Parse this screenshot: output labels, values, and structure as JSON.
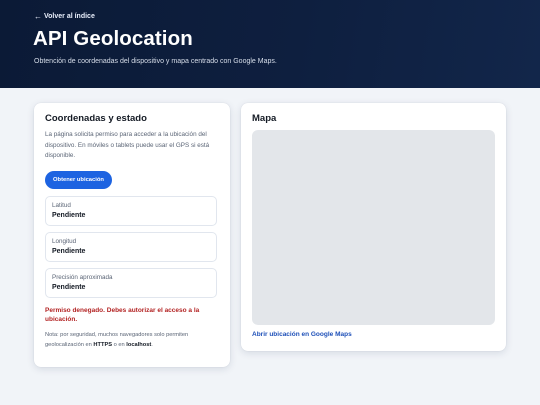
{
  "header": {
    "back_label": "Volver al índice",
    "title": "API Geolocation",
    "subtitle": "Obtención de coordenadas del dispositivo y mapa centrado con Google Maps."
  },
  "status_card": {
    "title": "Coordenadas y estado",
    "description": "La página solicita permiso para acceder a la ubicación del dispositivo. En móviles o tablets puede usar el GPS si está disponible.",
    "button_label": "Obtener ubicación",
    "fields": [
      {
        "label": "Latitud",
        "value": "Pendiente"
      },
      {
        "label": "Longitud",
        "value": "Pendiente"
      },
      {
        "label": "Precisión aproximada",
        "value": "Pendiente"
      }
    ],
    "error_message": "Permiso denegado. Debes autorizar el acceso a la ubicación.",
    "note": {
      "prefix": "Nota: por seguridad, muchos navegadores solo permiten geolocalización en ",
      "https": "HTTPS",
      "middle": " o en ",
      "localhost": "localhost",
      "suffix": "."
    }
  },
  "map_card": {
    "title": "Mapa",
    "link_label": "Abrir ubicación en Google Maps"
  },
  "colors": {
    "header_bg": "#0e1f3f",
    "accent": "#1d63e1",
    "error": "#b32323",
    "link": "#1d4fb8"
  }
}
